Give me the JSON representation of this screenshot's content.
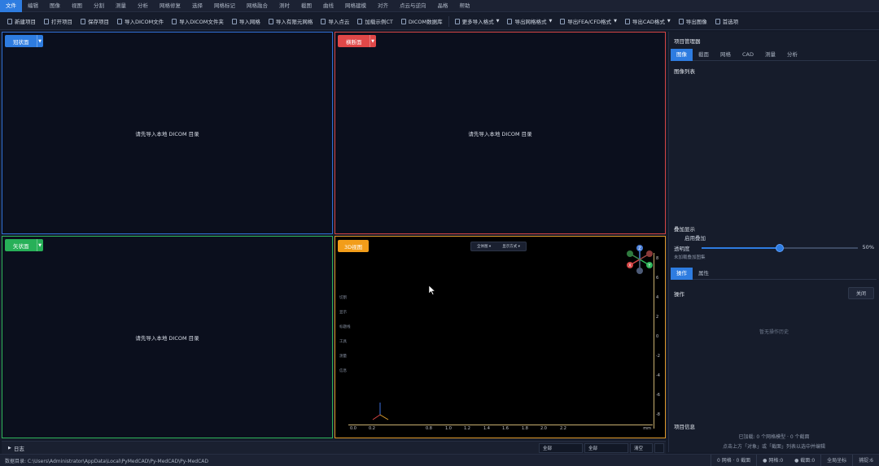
{
  "menu": {
    "items": [
      "文件",
      "编辑",
      "图像",
      "视图",
      "分割",
      "测量",
      "分析",
      "网格修复",
      "选择",
      "网格标记",
      "网格融合",
      "测时",
      "截图",
      "曲线",
      "网格建模",
      "对齐",
      "点云与逆向",
      "晶格",
      "帮助"
    ]
  },
  "toolbar": {
    "new_project": "新建项目",
    "open_project": "打开项目",
    "save_project": "保存项目",
    "import_dicom_file": "导入DICOM文件",
    "import_dicom_folder": "导入DICOM文件夹",
    "import_mesh": "导入网格",
    "import_fem_mesh": "导入有限元网格",
    "import_point_cloud": "导入点云",
    "load_sample_ct": "加载示例CT",
    "dicom_database": "DICOM数据库",
    "more_import": "更多导入格式",
    "export_mesh": "导出网格格式",
    "export_fea": "导出FEA/CFD格式",
    "export_cad": "导出CAD格式",
    "export_image": "导出图像",
    "preferences": "首选项"
  },
  "viewports": {
    "coronal": {
      "label": "冠状面",
      "message": "请先导入本地 DICOM 目录"
    },
    "axial": {
      "label": "横断面",
      "message": "请先导入本地 DICOM 目录"
    },
    "sagittal": {
      "label": "矢状面",
      "message": "请先导入本地 DICOM 目录"
    },
    "view3d": {
      "label": "3D视图",
      "control_1": "全体图 ▾",
      "control_2": "显示方式 ▾",
      "side_labels": [
        "切割",
        "显示",
        "标题线",
        "工具",
        "测量",
        "信息"
      ],
      "h_ticks": [
        "0.0",
        "0.2",
        "0.8",
        "1.0",
        "1.2",
        "1.4",
        "1.6",
        "1.8",
        "2.0",
        "2.2"
      ],
      "h_unit": "mm",
      "v_ticks": [
        "8",
        "6",
        "4",
        "2",
        "0",
        "-2",
        "-4",
        "-6",
        "-8"
      ]
    }
  },
  "logbar": {
    "label": "日志",
    "filter_1": "全部",
    "filter_2": "全部",
    "filter_3": "清空"
  },
  "statusbar": {
    "path": "数据目录: C:\\Users\\Administrator\\AppData\\Local\\PyMedCAD\\Py-MedCAD\\Py-MedCAD",
    "meshes": "0 网格 · 0 截面",
    "mesh_count": "● 网格:0",
    "section_count": "● 截面:0",
    "global_coord": "全局坐标",
    "snap": "捕捉:6"
  },
  "panel": {
    "project_manager": "项目管理器",
    "tabs": [
      "图像",
      "截面",
      "网格",
      "CAD",
      "测量",
      "分析"
    ],
    "image_list": "图像列表",
    "overlay_title": "叠加显示",
    "overlay_enable": "启用叠加",
    "opacity_label": "透明度",
    "opacity_value": "50%",
    "opacity_level": 0.5,
    "overlay_hint": "未加载叠加图集",
    "props_tabs": [
      "操作",
      "属性"
    ],
    "ops_title": "操作",
    "ops_close": "关闭",
    "ops_empty": "暂无操作历史",
    "info_title": "项目信息",
    "info_line1": "已加载: 0 个网格模型 · 0 个截面",
    "info_line2": "点击上方「对象」或「截面」列表以选中并编辑"
  },
  "colors": {
    "accent": "#2e7ce0",
    "coronal": "#2f6fd6",
    "axial": "#d64545",
    "sagittal": "#2fb55a",
    "view3d": "#e09a2a"
  }
}
